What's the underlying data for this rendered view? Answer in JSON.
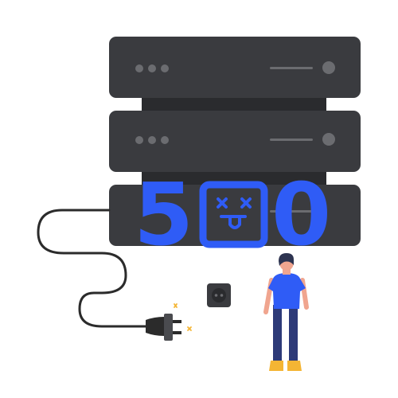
{
  "error": {
    "digit_first": "5",
    "digit_last": "0",
    "middle_glyph": "dead-face-icon"
  },
  "colors": {
    "accent": "#2f5cf6",
    "server": "#3a3b3f",
    "server_gap": "#2a2b2e",
    "server_light": "#6b6c70",
    "cable": "#2b2b2b",
    "plug": "#4a4b4f",
    "skin": "#f0a58f",
    "hair": "#2d3350",
    "pants": "#2d3a78",
    "shoes": "#f4b534",
    "spark": "#f4b534"
  }
}
